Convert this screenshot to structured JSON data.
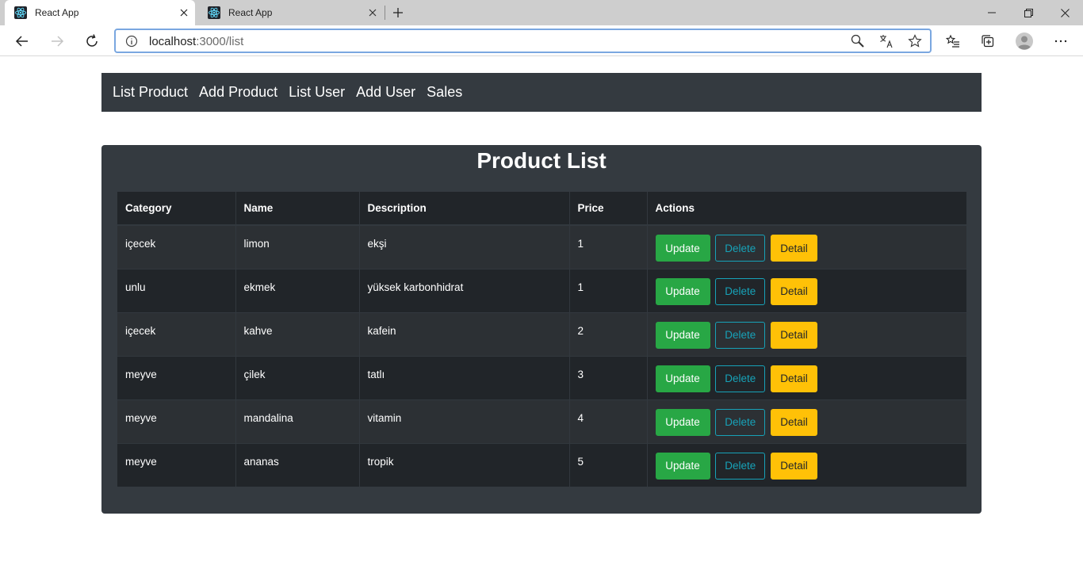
{
  "browser": {
    "tabs": [
      {
        "title": "React App",
        "active": true
      },
      {
        "title": "React App",
        "active": false
      }
    ],
    "url_host": "localhost",
    "url_path": ":3000/list"
  },
  "navbar": {
    "items": [
      "List Product",
      "Add Product",
      "List User",
      "Add User",
      "Sales"
    ]
  },
  "page": {
    "title": "Product List",
    "columns": [
      "Category",
      "Name",
      "Description",
      "Price",
      "Actions"
    ],
    "actions": {
      "update": "Update",
      "delete": "Delete",
      "detail": "Detail"
    },
    "rows": [
      {
        "category": "içecek",
        "name": "limon",
        "description": "ekşi",
        "price": "1"
      },
      {
        "category": "unlu",
        "name": "ekmek",
        "description": "yüksek karbonhidrat",
        "price": "1"
      },
      {
        "category": "içecek",
        "name": "kahve",
        "description": "kafein",
        "price": "2"
      },
      {
        "category": "meyve",
        "name": "çilek",
        "description": "tatlı",
        "price": "3"
      },
      {
        "category": "meyve",
        "name": "mandalina",
        "description": "vitamin",
        "price": "4"
      },
      {
        "category": "meyve",
        "name": "ananas",
        "description": "tropik",
        "price": "5"
      }
    ]
  },
  "colors": {
    "navbar_bg": "#343a40",
    "table_dark": "#212529",
    "update": "#28a745",
    "delete": "#17a2b8",
    "detail": "#ffc107"
  },
  "icons": {
    "tab_favicon": "react-logo-icon",
    "tab_close": "close-icon",
    "new_tab": "plus-icon",
    "back": "arrow-left-icon",
    "forward": "arrow-right-icon",
    "reload": "reload-icon",
    "site_info": "info-icon",
    "zoom": "magnifier-icon",
    "translate": "translate-icon",
    "favorite": "star-icon",
    "favorites": "favorites-icon",
    "collections": "collections-icon",
    "profile": "avatar-icon",
    "menu": "more-icon"
  }
}
